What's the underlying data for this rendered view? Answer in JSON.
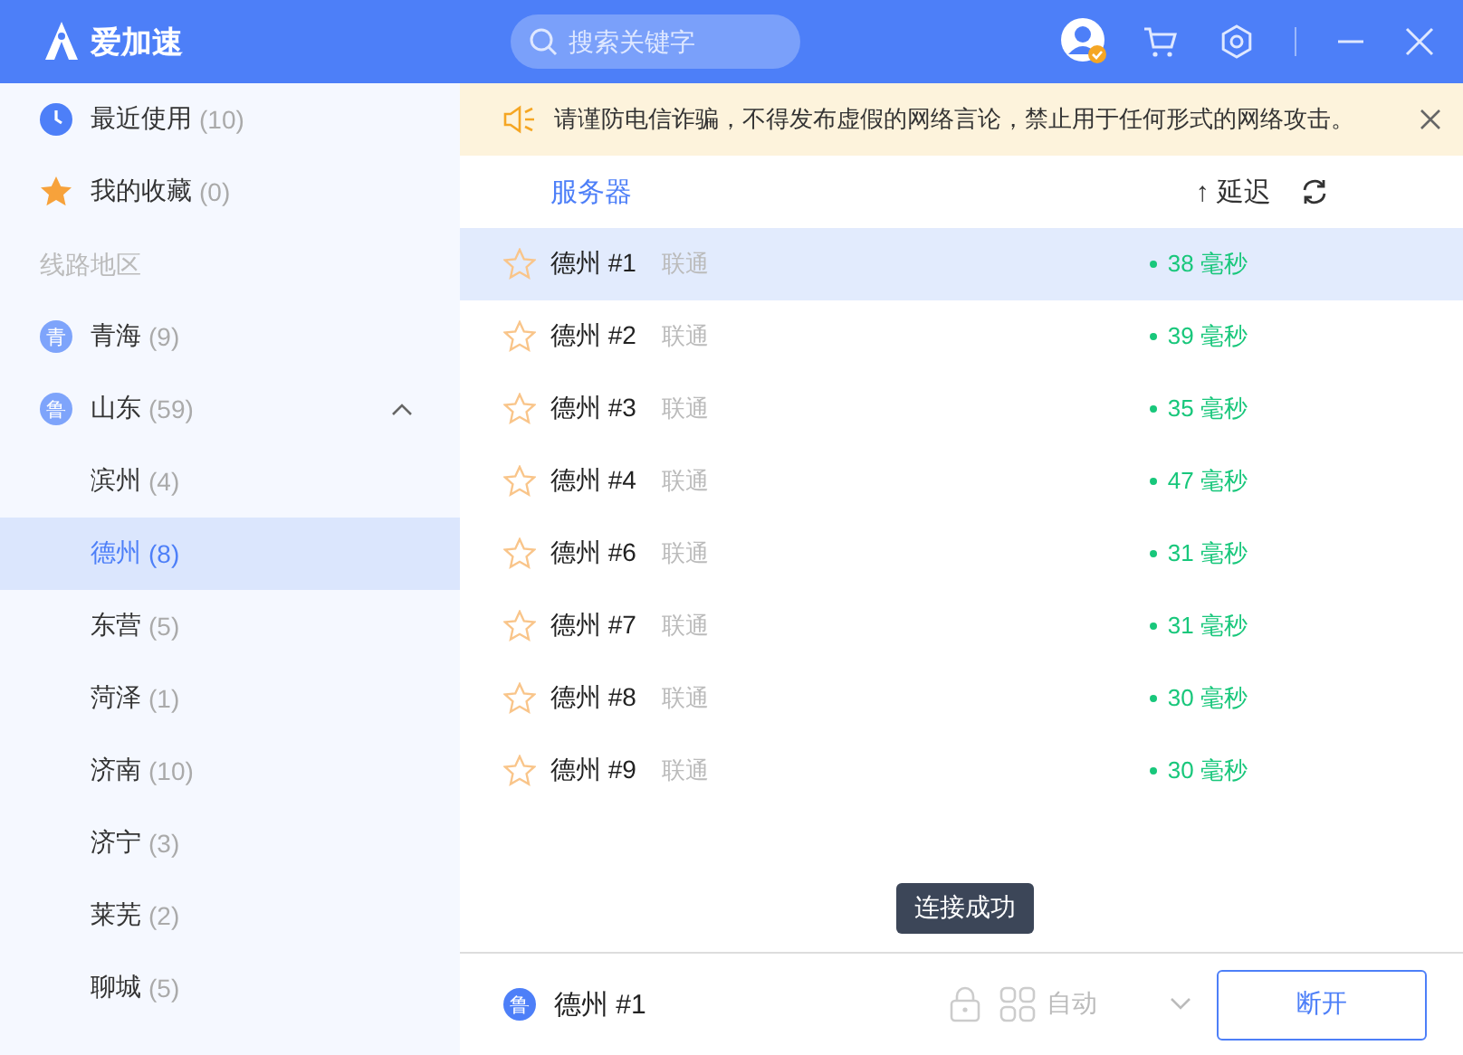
{
  "app": {
    "title": "爱加速"
  },
  "search": {
    "placeholder": "搜索关键字"
  },
  "sidebar": {
    "quick_items": [
      {
        "kind": "clock",
        "label": "最近使用",
        "count": "(10)"
      },
      {
        "kind": "star",
        "label": "我的收藏",
        "count": "(0)"
      }
    ],
    "section_label": "线路地区",
    "regions": [
      {
        "badge": "青",
        "label": "青海",
        "count": "(9)",
        "expanded": false
      },
      {
        "badge": "鲁",
        "label": "山东",
        "count": "(59)",
        "expanded": true,
        "children": [
          {
            "label": "滨州",
            "count": "(4)",
            "selected": false
          },
          {
            "label": "德州",
            "count": "(8)",
            "selected": true
          },
          {
            "label": "东营",
            "count": "(5)",
            "selected": false
          },
          {
            "label": "菏泽",
            "count": "(1)",
            "selected": false
          },
          {
            "label": "济南",
            "count": "(10)",
            "selected": false
          },
          {
            "label": "济宁",
            "count": "(3)",
            "selected": false
          },
          {
            "label": "莱芜",
            "count": "(2)",
            "selected": false
          },
          {
            "label": "聊城",
            "count": "(5)",
            "selected": false
          }
        ]
      }
    ]
  },
  "notice": {
    "text": "请谨防电信诈骗，不得发布虚假的网络言论，禁止用于任何形式的网络攻击。"
  },
  "table": {
    "columns": [
      "服务器",
      "延迟"
    ],
    "sort_arrow": "↑",
    "rows": [
      {
        "name": "德州 #1",
        "isp": "联通",
        "latency": "38 毫秒",
        "favorite": false,
        "selected": true
      },
      {
        "name": "德州 #2",
        "isp": "联通",
        "latency": "39 毫秒",
        "favorite": false,
        "selected": false
      },
      {
        "name": "德州 #3",
        "isp": "联通",
        "latency": "35 毫秒",
        "favorite": false,
        "selected": false
      },
      {
        "name": "德州 #4",
        "isp": "联通",
        "latency": "47 毫秒",
        "favorite": false,
        "selected": false
      },
      {
        "name": "德州 #6",
        "isp": "联通",
        "latency": "31 毫秒",
        "favorite": false,
        "selected": false
      },
      {
        "name": "德州 #7",
        "isp": "联通",
        "latency": "31 毫秒",
        "favorite": false,
        "selected": false
      },
      {
        "name": "德州 #8",
        "isp": "联通",
        "latency": "30 毫秒",
        "favorite": false,
        "selected": false
      },
      {
        "name": "德州 #9",
        "isp": "联通",
        "latency": "30 毫秒",
        "favorite": false,
        "selected": false
      }
    ]
  },
  "toast": {
    "text": "连接成功"
  },
  "footer": {
    "badge": "鲁",
    "server": "德州 #1",
    "mode": "自动",
    "button": "断开"
  }
}
